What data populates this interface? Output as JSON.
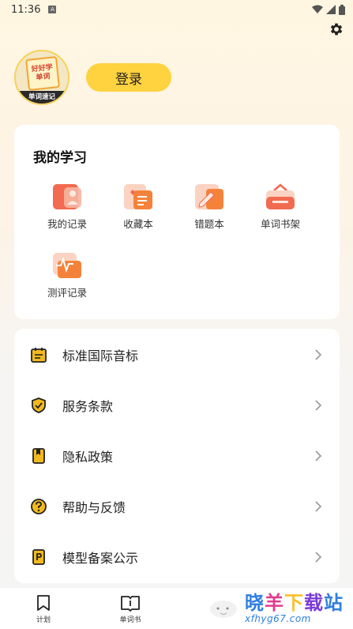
{
  "status": {
    "time": "11:36",
    "sim": "A"
  },
  "profile": {
    "avatar_line1": "好好学",
    "avatar_line2": "单词",
    "avatar_banner": "单词速记",
    "login_label": "登录"
  },
  "study": {
    "title": "我的学习",
    "items": [
      {
        "label": "我的记录",
        "icon": "record-icon"
      },
      {
        "label": "收藏本",
        "icon": "favorites-icon"
      },
      {
        "label": "错题本",
        "icon": "mistakes-icon"
      },
      {
        "label": "单词书架",
        "icon": "bookshelf-icon"
      },
      {
        "label": "测评记录",
        "icon": "assessment-icon"
      }
    ]
  },
  "menu": {
    "items": [
      {
        "label": "标准国际音标",
        "icon": "calendar-icon"
      },
      {
        "label": "服务条款",
        "icon": "shield-icon"
      },
      {
        "label": "隐私政策",
        "icon": "bookmark-icon"
      },
      {
        "label": "帮助与反馈",
        "icon": "help-icon"
      },
      {
        "label": "模型备案公示",
        "icon": "document-icon"
      }
    ]
  },
  "tabs": [
    {
      "label": "计划",
      "icon": "plan-icon"
    },
    {
      "label": "单词书",
      "icon": "wordbook-icon"
    }
  ],
  "watermark": {
    "title": "晓羊下载站",
    "url": "xfhyg67.com"
  },
  "colors": {
    "accent": "#ffd23f",
    "icon_orange": "#f5823a",
    "icon_yellow": "#f2b91e"
  }
}
